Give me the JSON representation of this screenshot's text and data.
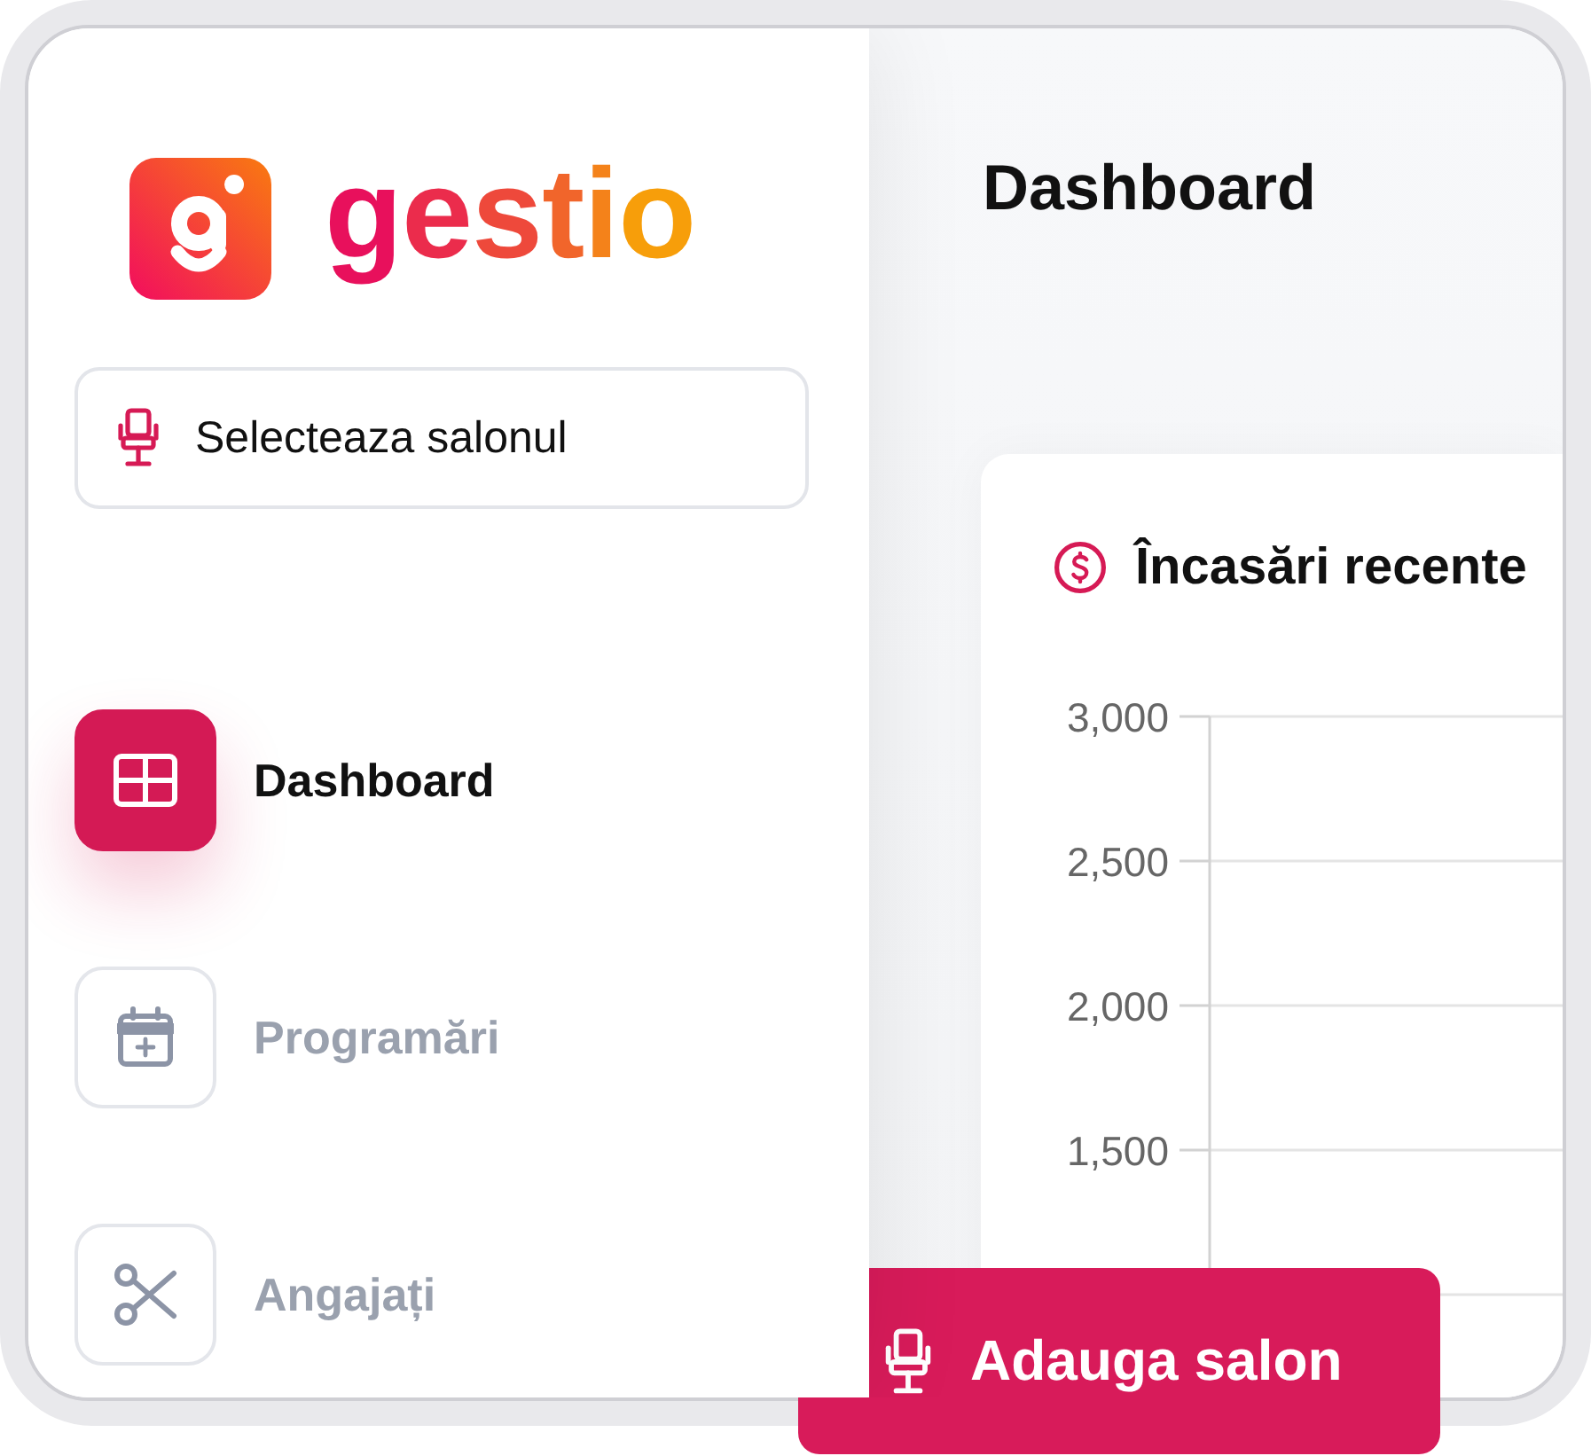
{
  "logo": {
    "wordmark": "gestio"
  },
  "sidebar": {
    "salon_select": {
      "label": "Selecteaza salonul"
    },
    "nav": [
      {
        "label": "Dashboard",
        "selected": true
      },
      {
        "label": "Programări",
        "selected": false
      },
      {
        "label": "Angajați",
        "selected": false
      }
    ]
  },
  "header": {
    "title": "Dashboard"
  },
  "card": {
    "title": "Încasări recente",
    "y_axis_labels": [
      "3,000",
      "2,500",
      "2,000",
      "1,500"
    ]
  },
  "action_button": {
    "label": "Adauga salon"
  }
}
